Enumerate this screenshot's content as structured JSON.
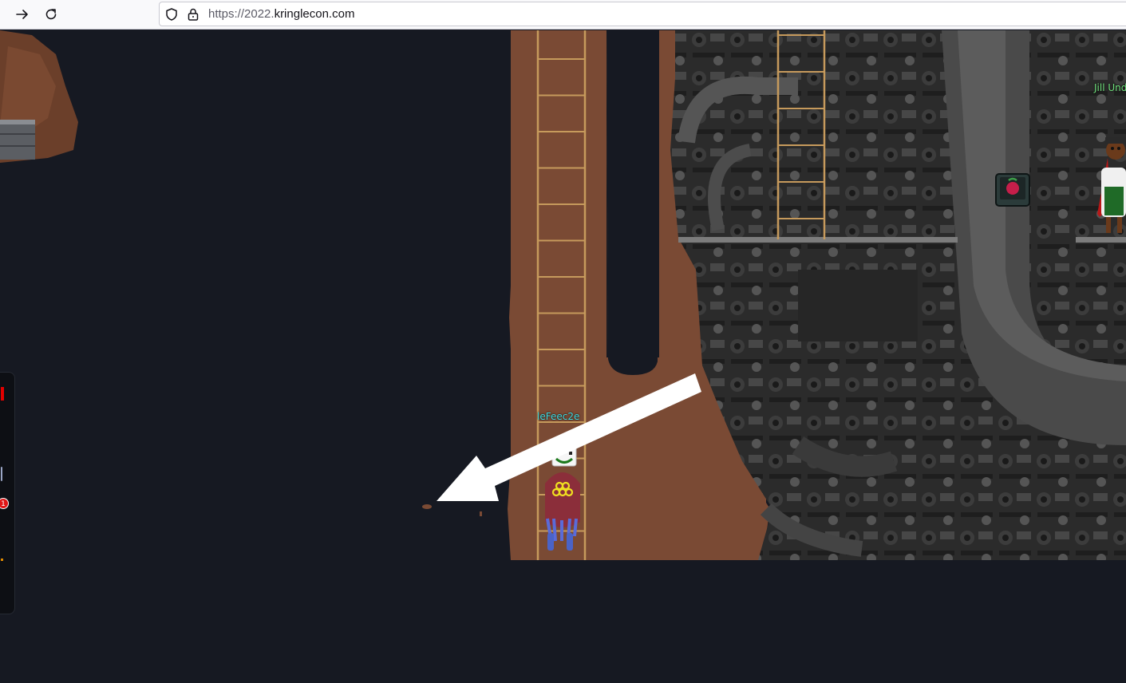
{
  "browser": {
    "url_prefix": "https://2022.",
    "url_domain": "kringlecon.com",
    "forward_icon": "arrow-right-icon",
    "reload_icon": "reload-icon",
    "shield_icon": "shield-icon",
    "lock_icon": "lock-icon"
  },
  "game": {
    "player_name": "leFeec2e",
    "npc_name": "Jill Und",
    "terminal_icon": "raspberry-pi-terminal-icon",
    "arrow_annotation_icon": "white-arrow-icon"
  },
  "sidebar": {
    "notification_count": "1"
  },
  "colors": {
    "background": "#161922",
    "dirt": "#7a4a34",
    "ladder": "#c69a5c",
    "player_name": "#3ed8e0",
    "npc_name": "#6fe07c"
  }
}
